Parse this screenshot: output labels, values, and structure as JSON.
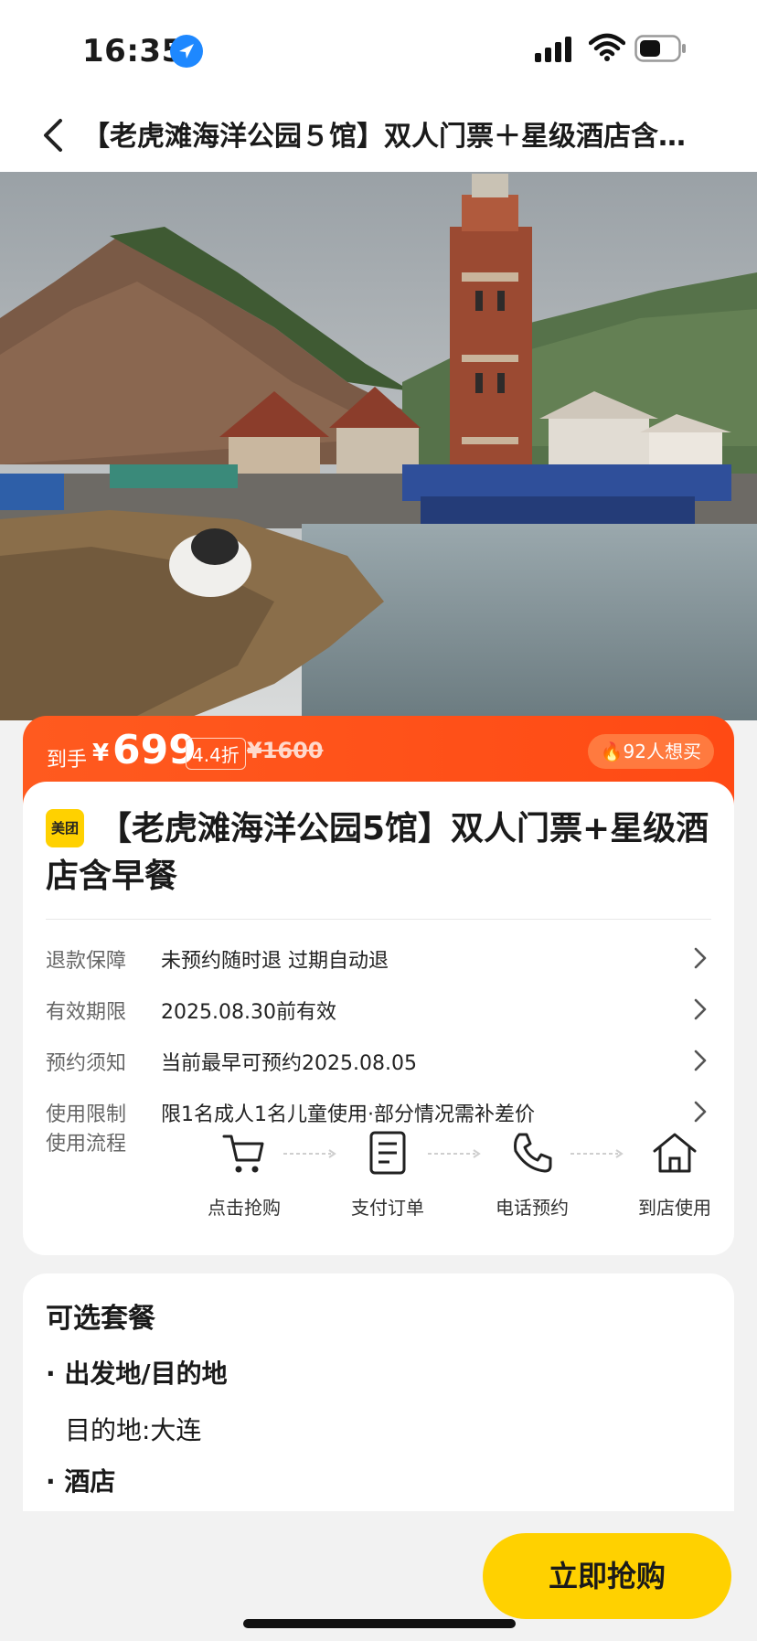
{
  "status_bar": {
    "time": "16:35"
  },
  "nav": {
    "title": "【老虎滩海洋公园５馆】双人门票＋星级酒店含…"
  },
  "price": {
    "label": "到手",
    "currency": "¥",
    "value": "699",
    "discount": "4.4折",
    "original": "¥1600",
    "want_count": "92人想买"
  },
  "product": {
    "brand_logo": "美团",
    "title": "【老虎滩海洋公园5馆】双人门票+星级酒店含早餐"
  },
  "info_rows": [
    {
      "label": "退款保障",
      "value": "未预约随时退 过期自动退"
    },
    {
      "label": "有效期限",
      "value": "2025.08.30前有效"
    },
    {
      "label": "预约须知",
      "value": "当前最早可预约2025.08.05"
    },
    {
      "label": "使用限制",
      "value": "限1名成人1名儿童使用·部分情况需补差价"
    }
  ],
  "flow": {
    "label": "使用流程",
    "steps": [
      {
        "label": "点击抢购",
        "icon": "cart-icon"
      },
      {
        "label": "支付订单",
        "icon": "document-icon"
      },
      {
        "label": "电话预约",
        "icon": "phone-icon"
      },
      {
        "label": "到店使用",
        "icon": "home-icon"
      }
    ]
  },
  "packages": {
    "heading": "可选套餐",
    "sections": [
      {
        "bullet": "·",
        "title": "出发地/目的地",
        "detail": "目的地:大连"
      },
      {
        "bullet": "·",
        "title": "酒店"
      }
    ]
  },
  "cta": {
    "buy_label": "立即抢购"
  },
  "colors": {
    "accent_orange": "#ff5a1f",
    "cta_yellow": "#ffd100",
    "brand_yellow": "#ffd100"
  }
}
